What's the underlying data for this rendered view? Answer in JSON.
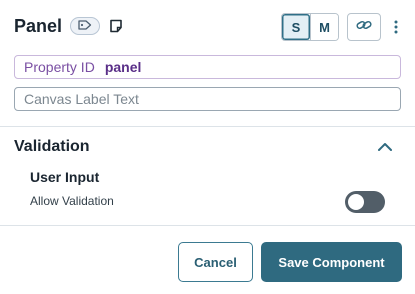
{
  "header": {
    "title": "Panel",
    "tag_icon": "tag-icon",
    "note_icon": "sticky-note-icon",
    "size_options": [
      "S",
      "M"
    ],
    "selected_size": "S",
    "link_icon": "link-icon",
    "menu_icon": "kebab-menu-icon"
  },
  "property": {
    "label": "Property ID",
    "value": "panel"
  },
  "canvas_label": {
    "placeholder": "Canvas Label Text",
    "value": ""
  },
  "validation": {
    "title": "Validation",
    "collapse_icon": "chevron-up-icon",
    "subheading": "User Input",
    "toggle_label": "Allow Validation",
    "toggle_on": false
  },
  "footer": {
    "cancel_label": "Cancel",
    "save_label": "Save Component"
  },
  "colors": {
    "accent": "#2f6a80",
    "property_text": "#5a2f88",
    "toggle_off": "#525e68"
  }
}
